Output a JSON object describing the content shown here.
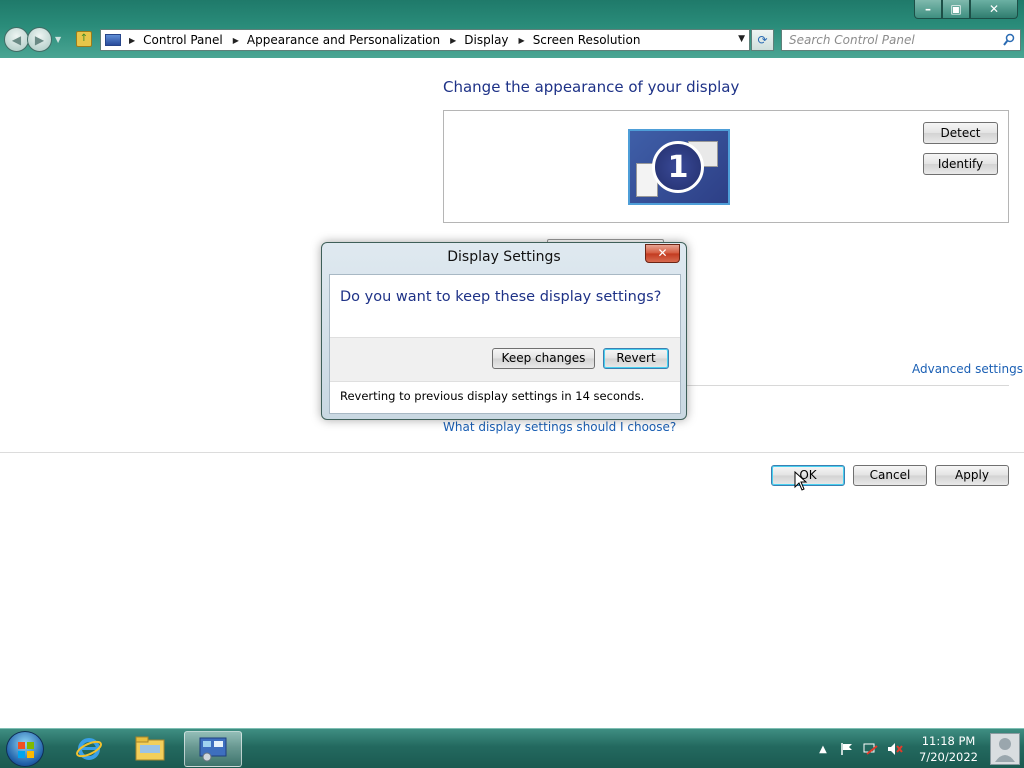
{
  "window": {
    "controls": {
      "minimize": "–",
      "maximize": "▣",
      "close": "✕"
    }
  },
  "address": {
    "crumbs": [
      "Control Panel",
      "Appearance and Personalization",
      "Display",
      "Screen Resolution"
    ]
  },
  "search": {
    "placeholder": "Search Control Panel"
  },
  "main": {
    "title": "Change the appearance of your display",
    "monitor_number": "1",
    "detect_label": "Detect",
    "identify_label": "Identify",
    "advanced_link": "Advanced settings",
    "help_link": "What display settings should I choose?",
    "ok_label": "OK",
    "cancel_label": "Cancel",
    "apply_label": "Apply"
  },
  "dialog": {
    "title": "Display Settings",
    "close_label": "✕",
    "question": "Do you want to keep these display settings?",
    "keep_label": "Keep changes",
    "revert_label": "Revert",
    "countdown_text": "Reverting to previous display settings in 14 seconds."
  },
  "taskbar": {
    "time": "11:18 PM",
    "date": "7/20/2022",
    "items": [
      "internet-explorer",
      "windows-explorer",
      "control-panel"
    ]
  },
  "colors": {
    "title_blue": "#1e3287",
    "link_blue": "#1a5fb4",
    "chrome_teal": "#2a8c7a"
  }
}
